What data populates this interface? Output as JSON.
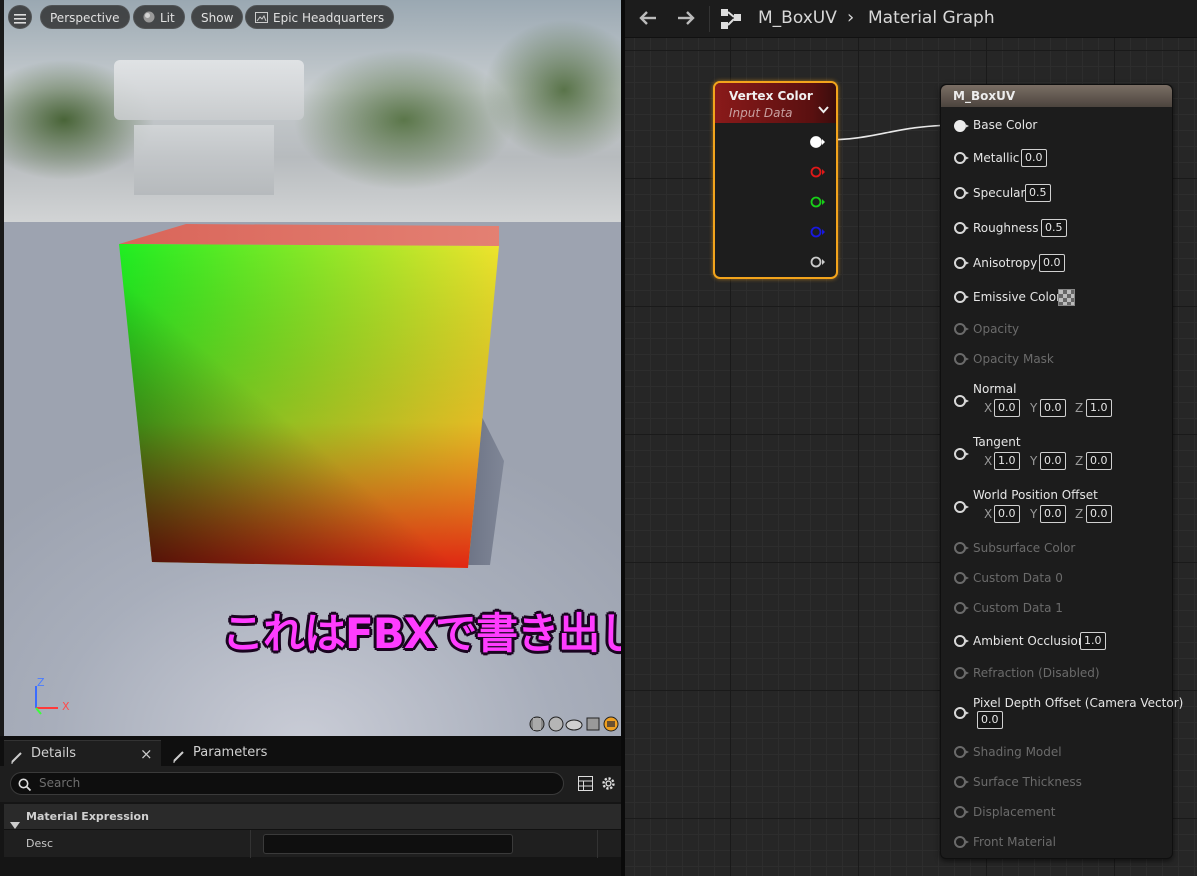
{
  "viewport": {
    "menu_icon": "hamburger-icon",
    "buttons": {
      "perspective": "Perspective",
      "lit": "Lit",
      "show": "Show",
      "location": "Epic Headquarters"
    },
    "axis": {
      "z": "Z",
      "x": "X"
    },
    "cube_colors": {
      "top_left": "#19f21a",
      "top_right": "#f0e52a",
      "bottom_left": "#3a1a08",
      "bottom_right": "#f01a10"
    }
  },
  "details": {
    "tabs": [
      {
        "label": "Details",
        "icon": "pencil-icon",
        "close": "×"
      },
      {
        "label": "Parameters",
        "icon": "pencil-icon"
      }
    ],
    "search_placeholder": "Search",
    "section_title": "Material Expression",
    "desc_label": "Desc",
    "desc_value": ""
  },
  "graph": {
    "breadcrumb_root": "M_BoxUV",
    "breadcrumb_sep": "›",
    "breadcrumb_current": "Material Graph",
    "vertex_color_node": {
      "title": "Vertex Color",
      "subtitle": "Input Data",
      "pin_colors": [
        "#ffffff",
        "#e01818",
        "#18d018",
        "#1818e0",
        "#cccccc"
      ]
    },
    "material_node": {
      "title": "M_BoxUV",
      "base_color": "Base Color",
      "metallic": "Metallic",
      "metallic_val": "0.0",
      "specular": "Specular",
      "specular_val": "0.5",
      "roughness": "Roughness",
      "roughness_val": "0.5",
      "anisotropy": "Anisotropy",
      "anisotropy_val": "0.0",
      "emissive": "Emissive Color",
      "opacity": "Opacity",
      "opacity_mask": "Opacity Mask",
      "normal": "Normal",
      "normal_x": "0.0",
      "normal_y": "0.0",
      "normal_z": "1.0",
      "tangent": "Tangent",
      "tangent_x": "1.0",
      "tangent_y": "0.0",
      "tangent_z": "0.0",
      "wpo": "World Position Offset",
      "wpo_x": "0.0",
      "wpo_y": "0.0",
      "wpo_z": "0.0",
      "subsurface": "Subsurface Color",
      "custom0": "Custom Data 0",
      "custom1": "Custom Data 1",
      "ao": "Ambient Occlusion",
      "ao_val": "1.0",
      "refraction": "Refraction (Disabled)",
      "pdo": "Pixel Depth Offset (Camera Vector)",
      "pdo_val": "0.0",
      "shading": "Shading Model",
      "thickness": "Surface Thickness",
      "displacement": "Displacement",
      "front": "Front Material",
      "x_lbl": "X",
      "y_lbl": "Y",
      "z_lbl": "Z"
    }
  },
  "overlay_caption": "これはFBXで書き出したモデル"
}
